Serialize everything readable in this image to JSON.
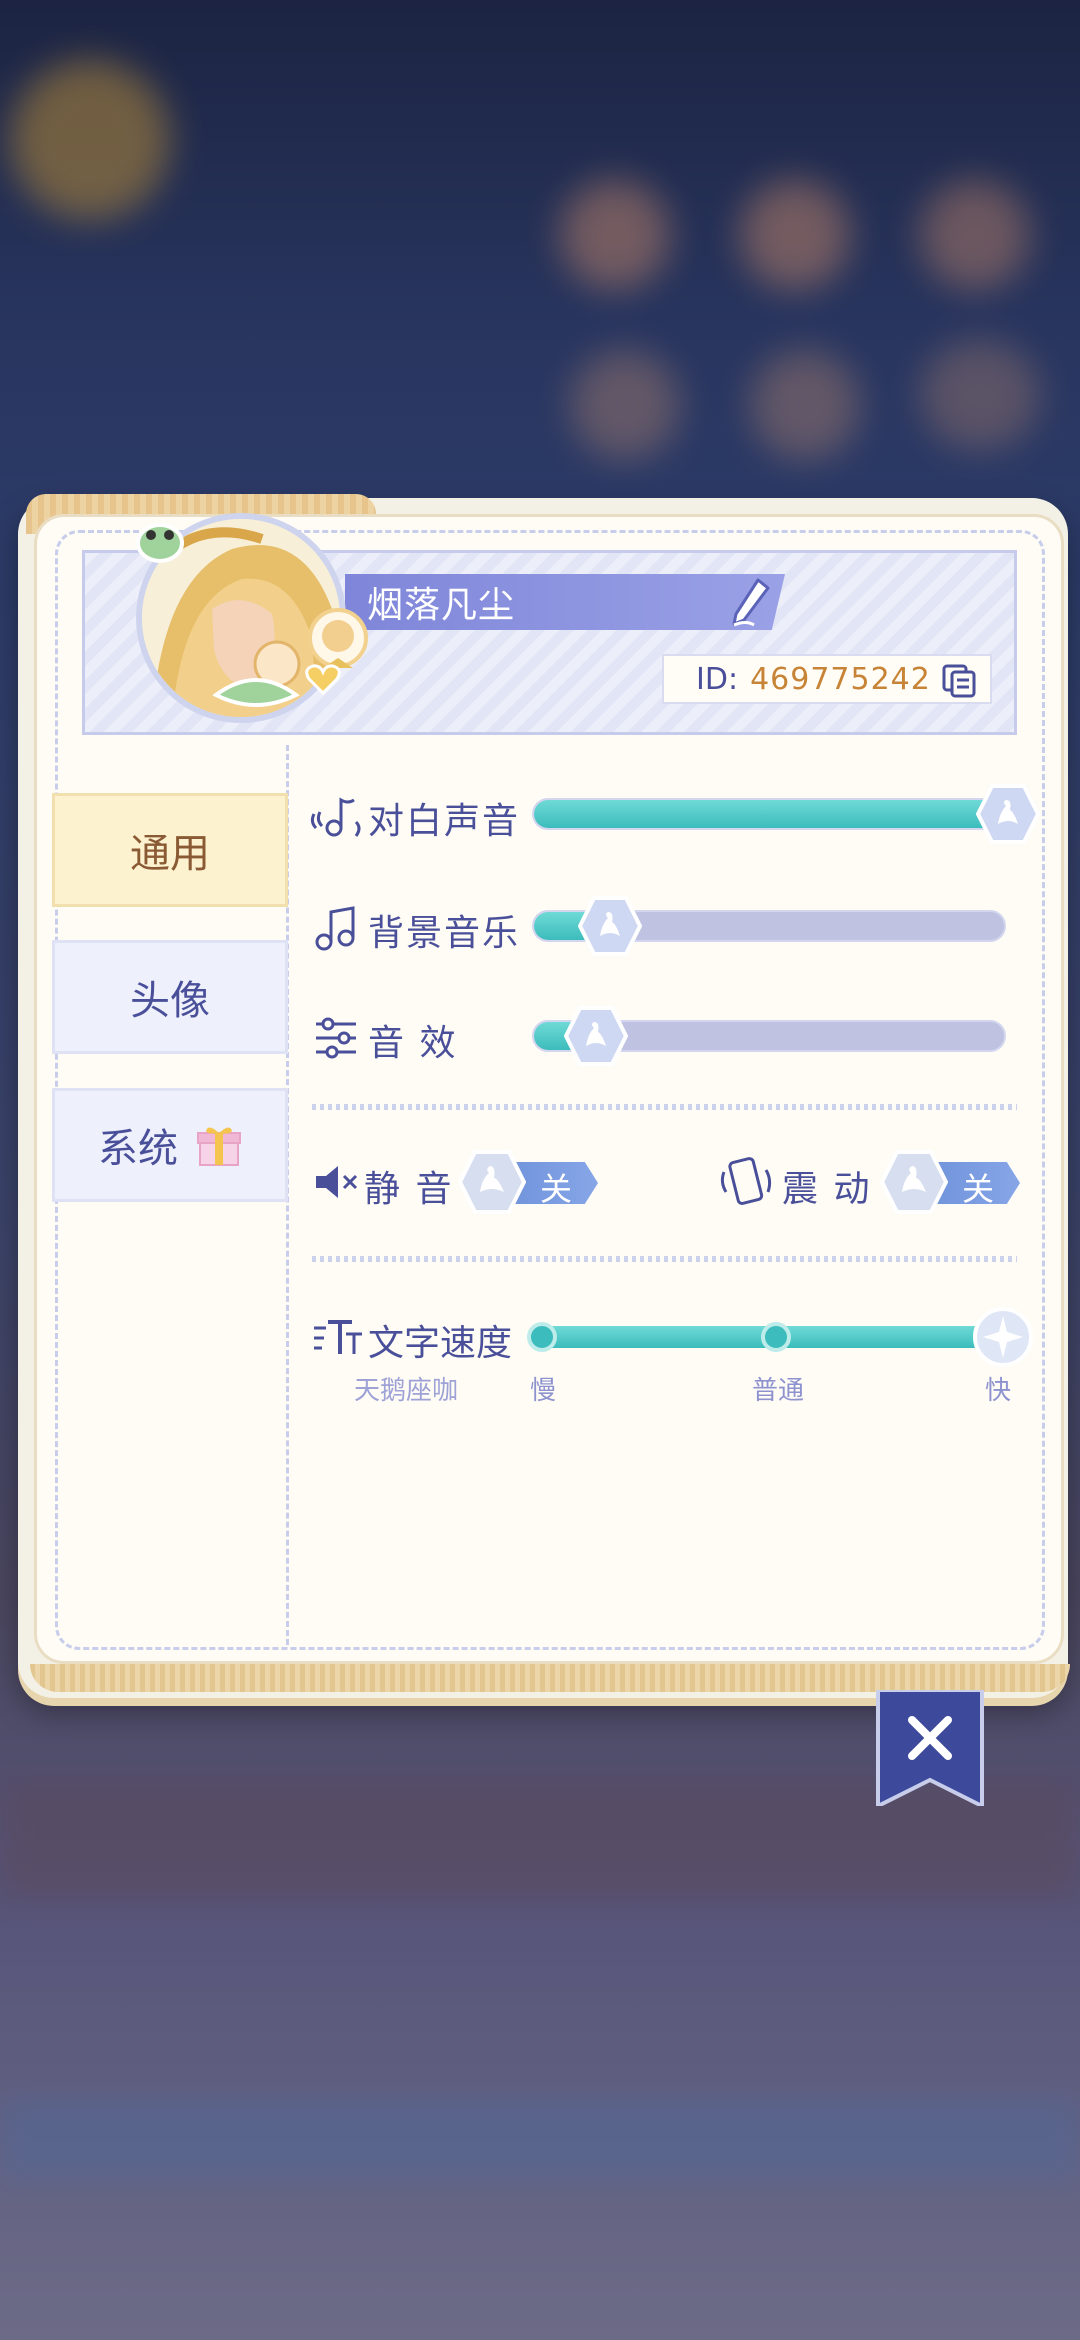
{
  "profile": {
    "username": "烟落凡尘",
    "id_label": "ID:",
    "id_value": "469775242"
  },
  "sidebar": {
    "tabs": [
      {
        "label": "通用",
        "active": true
      },
      {
        "label": "头像",
        "active": false
      },
      {
        "label": "系统",
        "active": false
      }
    ]
  },
  "settings": {
    "dialogue_voice": {
      "label": "对白声音",
      "level": 1.0
    },
    "bgm": {
      "label": "背景音乐",
      "level": 0.15
    },
    "sfx": {
      "label": "音 效",
      "level": 0.13
    },
    "mute": {
      "label": "静 音",
      "state_label": "关"
    },
    "vibration": {
      "label": "震 动",
      "state_label": "关"
    },
    "text_speed": {
      "label": "文字速度",
      "watermark": "天鹅座咖",
      "options": [
        "慢",
        "普通",
        "快"
      ],
      "selected": "快"
    }
  },
  "colors": {
    "accent_teal": "#3cbcbc",
    "text_primary": "#4a4f9a",
    "id_value": "#c88436",
    "tab_active_bg": "#fdf2cf",
    "ribbon": "#3d4a9c"
  },
  "icons": [
    "music-note-voice-icon",
    "music-note-icon",
    "equalizer-icon",
    "speaker-mute-icon",
    "phone-vibrate-icon",
    "text-speed-icon",
    "edit-pencil-icon",
    "copy-icon",
    "gift-icon",
    "close-icon",
    "swan-knob-icon"
  ]
}
